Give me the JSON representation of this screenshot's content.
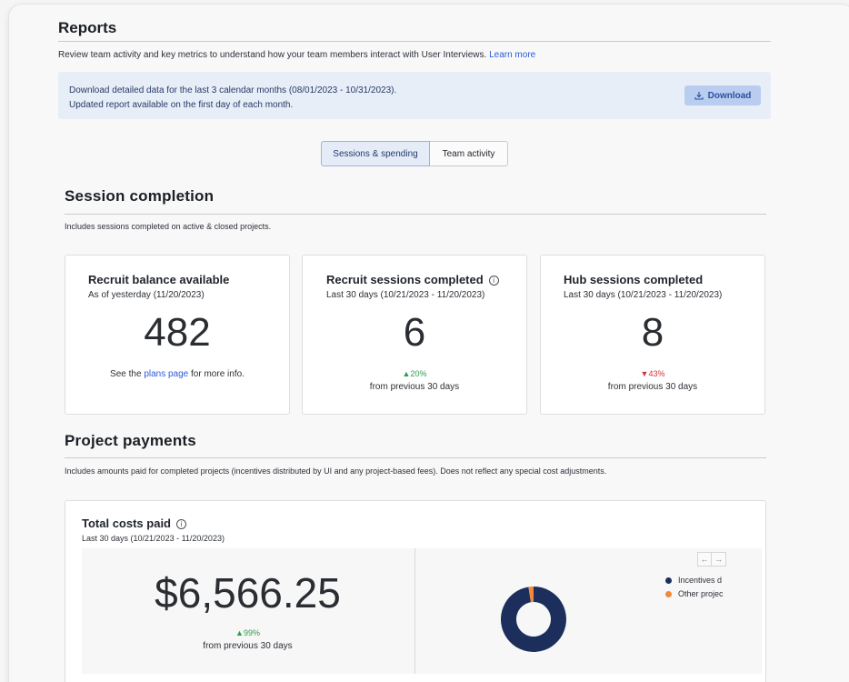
{
  "header": {
    "title": "Reports",
    "description": "Review team activity and key metrics to understand how your team members interact with User Interviews.",
    "learn_more": "Learn more"
  },
  "banner": {
    "line1": "Download detailed data for the last 3 calendar months (08/01/2023 - 10/31/2023).",
    "line2": "Updated report available on the first day of each month.",
    "download_label": "Download",
    "download_icon": "download-icon"
  },
  "tabs": [
    {
      "label": "Sessions & spending",
      "active": true
    },
    {
      "label": "Team activity",
      "active": false
    }
  ],
  "session_completion": {
    "title": "Session completion",
    "description": "Includes sessions completed on active & closed projects.",
    "cards": [
      {
        "title": "Recruit balance available",
        "subtitle": "As of yesterday (11/20/2023)",
        "value": "482",
        "footer_pre": "See the ",
        "footer_link": "plans page",
        "footer_post": " for more info."
      },
      {
        "title": "Recruit sessions completed",
        "info_icon": "info-icon",
        "subtitle": "Last 30 days (10/21/2023 - 11/20/2023)",
        "value": "6",
        "change": "20%",
        "change_direction": "up",
        "change_label": "from previous 30 days"
      },
      {
        "title": "Hub sessions completed",
        "subtitle": "Last 30 days (10/21/2023 - 11/20/2023)",
        "value": "8",
        "change": "43%",
        "change_direction": "down",
        "change_label": "from previous 30 days"
      }
    ]
  },
  "project_payments": {
    "title": "Project payments",
    "description": "Includes amounts paid for completed projects (incentives distributed by UI and any project-based fees). Does not reflect any special cost adjustments.",
    "total": {
      "title": "Total costs paid",
      "info_icon": "info-icon",
      "subtitle": "Last 30 days (10/21/2023 - 11/20/2023)",
      "value": "$6,566.25",
      "change": "99%",
      "change_direction": "up",
      "change_label": "from previous 30 days"
    },
    "legend": [
      {
        "label": "Incentives d",
        "color": "#1c2f5c"
      },
      {
        "label": "Other projec",
        "color": "#f08a3a"
      }
    ],
    "legend_prev": "←",
    "legend_next": "→"
  },
  "chart_data": {
    "type": "pie",
    "categories": [
      "Incentives distributed",
      "Other project fees"
    ],
    "values": [
      97.5,
      2.5
    ],
    "colors": [
      "#1c2f5c",
      "#f08a3a"
    ],
    "donut": true
  },
  "colors": {
    "accent": "#2a5bd7",
    "positive": "#2e9e4a",
    "negative": "#d0343a",
    "navy": "#1c2f5c",
    "orange": "#f08a3a"
  }
}
